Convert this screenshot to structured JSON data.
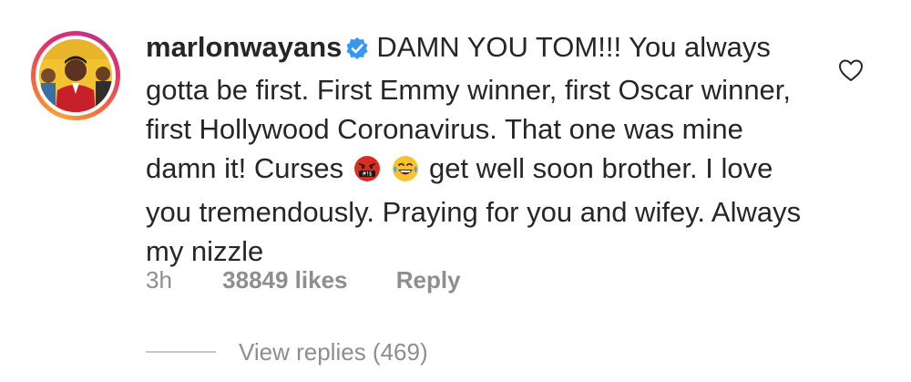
{
  "comment": {
    "username": "marlonwayans",
    "verified_icon": "verified-badge-icon",
    "text_part1": "DAMN YOU TOM!!! You always gotta be first. First Emmy winner, first Oscar winner, first Hollywood Coronavirus. That one was mine damn it! Curses",
    "emoji1": "angry-cursing-face-emoji",
    "emoji2": "tears-of-joy-emoji",
    "text_part2": "get well soon brother. I love you tremendously. Praying for you and wifey. Always my nizzle",
    "time": "3h",
    "likes": "38849 likes",
    "reply_label": "Reply",
    "view_replies": "View replies (469)",
    "like_icon": "heart-outline-icon"
  },
  "colors": {
    "text": "#262626",
    "secondary": "#8e8e8e",
    "verified": "#3897f0",
    "story_ring_start": "#f9a23b",
    "story_ring_end": "#c13584"
  }
}
